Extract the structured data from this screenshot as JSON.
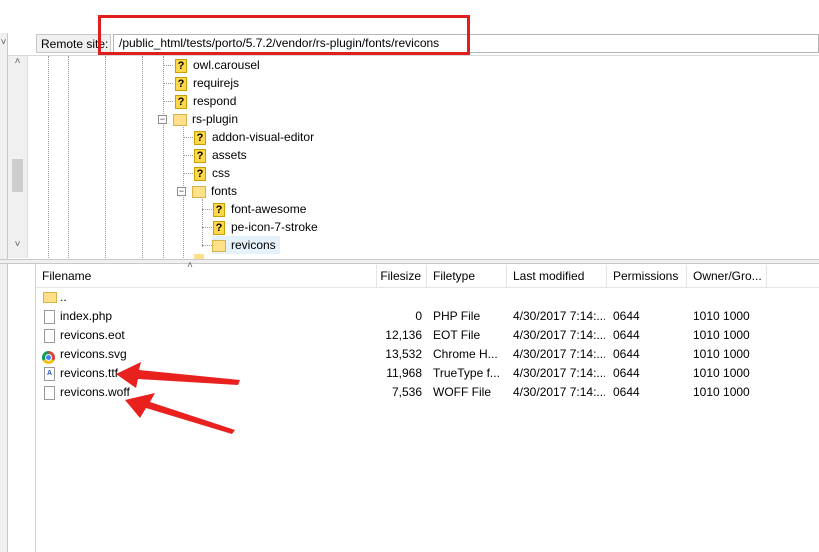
{
  "remote_site": {
    "label": "Remote site:",
    "path": "/public_html/tests/porto/5.7.2/vendor/rs-plugin/fonts/revicons"
  },
  "tree": {
    "items": [
      {
        "label": "owl.carousel",
        "icon": "unknown-folder-icon"
      },
      {
        "label": "requirejs",
        "icon": "unknown-folder-icon"
      },
      {
        "label": "respond",
        "icon": "unknown-folder-icon"
      },
      {
        "label": "rs-plugin",
        "icon": "folder-icon",
        "toggle": "−"
      },
      {
        "label": "addon-visual-editor",
        "icon": "unknown-folder-icon"
      },
      {
        "label": "assets",
        "icon": "unknown-folder-icon"
      },
      {
        "label": "css",
        "icon": "unknown-folder-icon"
      },
      {
        "label": "fonts",
        "icon": "folder-icon",
        "toggle": "−"
      },
      {
        "label": "font-awesome",
        "icon": "unknown-folder-icon"
      },
      {
        "label": "pe-icon-7-stroke",
        "icon": "unknown-folder-icon"
      },
      {
        "label": "revicons",
        "icon": "folder-icon"
      }
    ],
    "scroll_up": "˄",
    "scroll_down": "˅"
  },
  "file_list": {
    "sort_indicator": "˄",
    "columns": [
      "Filename",
      "Filesize",
      "Filetype",
      "Last modified",
      "Permissions",
      "Owner/Gro..."
    ],
    "rows": [
      {
        "name": "..",
        "size": "",
        "type": "",
        "modified": "",
        "perms": "",
        "owner": "",
        "icon": "folder-icon"
      },
      {
        "name": "index.php",
        "size": "0",
        "type": "PHP File",
        "modified": "4/30/2017 7:14:...",
        "perms": "0644",
        "owner": "1010 1000",
        "icon": "file-icon"
      },
      {
        "name": "revicons.eot",
        "size": "12,136",
        "type": "EOT File",
        "modified": "4/30/2017 7:14:...",
        "perms": "0644",
        "owner": "1010 1000",
        "icon": "file-icon"
      },
      {
        "name": "revicons.svg",
        "size": "13,532",
        "type": "Chrome H...",
        "modified": "4/30/2017 7:14:...",
        "perms": "0644",
        "owner": "1010 1000",
        "icon": "chrome-icon"
      },
      {
        "name": "revicons.ttf",
        "size": "11,968",
        "type": "TrueType f...",
        "modified": "4/30/2017 7:14:...",
        "perms": "0644",
        "owner": "1010 1000",
        "icon": "font-file-icon"
      },
      {
        "name": "revicons.woff",
        "size": "7,536",
        "type": "WOFF File",
        "modified": "4/30/2017 7:14:...",
        "perms": "0644",
        "owner": "1010 1000",
        "icon": "file-icon"
      }
    ]
  },
  "annotation": {
    "highlight_color": "#e01e1e",
    "arrow_color": "#e8211f"
  }
}
